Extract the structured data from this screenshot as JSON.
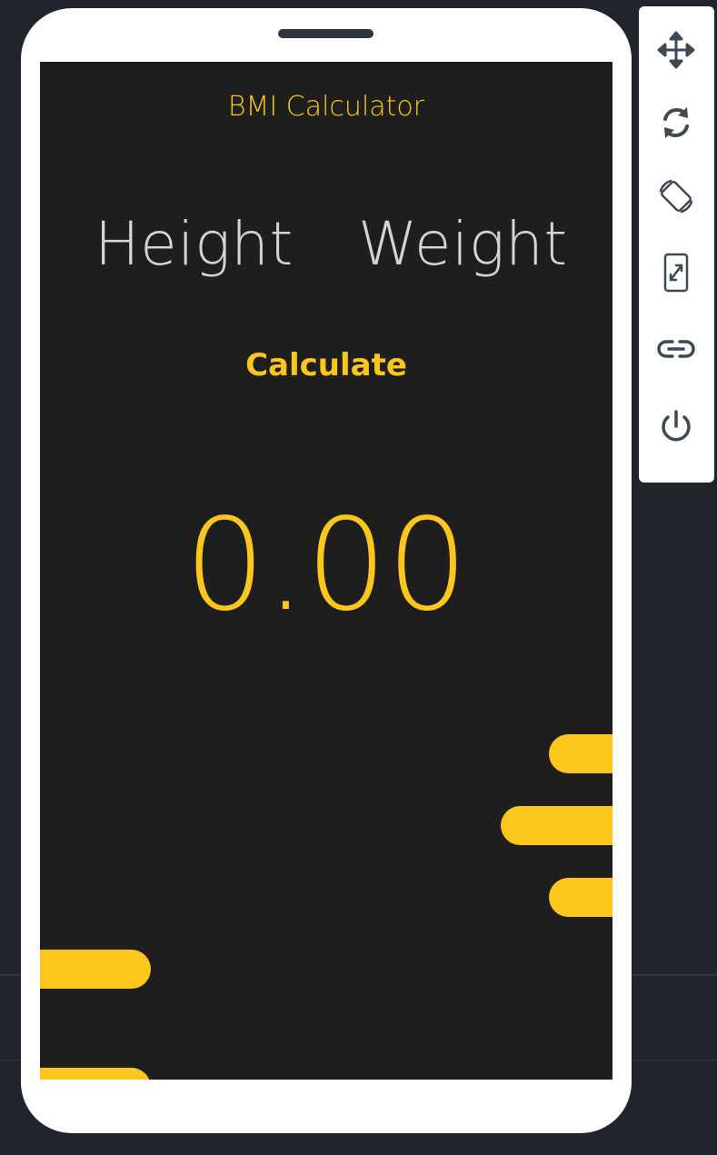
{
  "app": {
    "title": "BMI Calculator"
  },
  "inputs": {
    "height_label": "Height",
    "weight_label": "Weight"
  },
  "actions": {
    "calculate_label": "Calculate"
  },
  "result": {
    "value": "0.00"
  },
  "toolbar": {
    "items": [
      {
        "icon": "move-icon"
      },
      {
        "icon": "refresh-icon"
      },
      {
        "icon": "rotate-device-icon"
      },
      {
        "icon": "resize-device-icon"
      },
      {
        "icon": "link-icon"
      },
      {
        "icon": "power-icon"
      }
    ]
  },
  "colors": {
    "accent": "#fdc61d",
    "screen_background": "#1e1e1e",
    "label_text": "#d4d4d4",
    "page_background": "#21252b",
    "icon": "#3d4a56"
  }
}
